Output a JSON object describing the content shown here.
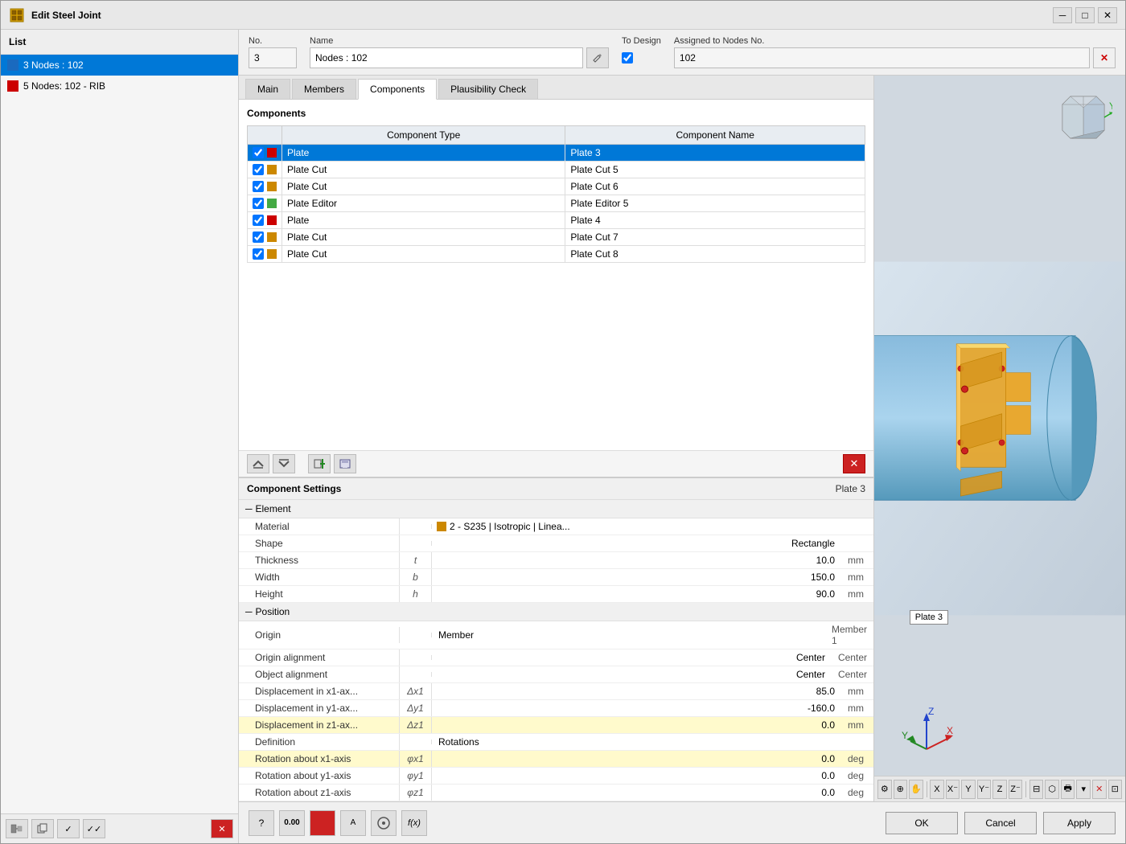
{
  "window": {
    "title": "Edit Steel Joint",
    "icon": "steel-joint-icon"
  },
  "list": {
    "header": "List",
    "items": [
      {
        "id": 1,
        "color": "blue",
        "text": "3 Nodes : 102",
        "selected": true
      },
      {
        "id": 2,
        "color": "red",
        "text": "5 Nodes: 102 - RIB",
        "selected": false
      }
    ]
  },
  "form": {
    "no_label": "No.",
    "no_value": "3",
    "name_label": "Name",
    "name_value": "Nodes : 102",
    "to_design_label": "To Design",
    "assigned_label": "Assigned to Nodes No.",
    "assigned_value": "102"
  },
  "tabs": [
    {
      "id": "main",
      "label": "Main",
      "active": false
    },
    {
      "id": "members",
      "label": "Members",
      "active": false
    },
    {
      "id": "components",
      "label": "Components",
      "active": true
    },
    {
      "id": "plausibility",
      "label": "Plausibility Check",
      "active": false
    }
  ],
  "components": {
    "title": "Components",
    "col_type": "Component Type",
    "col_name": "Component Name",
    "rows": [
      {
        "checked": true,
        "color": "red",
        "type": "Plate",
        "name": "Plate 3",
        "selected": true
      },
      {
        "checked": true,
        "color": "orange",
        "type": "Plate Cut",
        "name": "Plate Cut 5",
        "selected": false
      },
      {
        "checked": true,
        "color": "orange",
        "type": "Plate Cut",
        "name": "Plate Cut 6",
        "selected": false
      },
      {
        "checked": true,
        "color": "green",
        "type": "Plate Editor",
        "name": "Plate Editor 5",
        "selected": false
      },
      {
        "checked": true,
        "color": "red",
        "type": "Plate",
        "name": "Plate 4",
        "selected": false
      },
      {
        "checked": true,
        "color": "orange",
        "type": "Plate Cut",
        "name": "Plate Cut 7",
        "selected": false
      },
      {
        "checked": true,
        "color": "orange",
        "type": "Plate Cut",
        "name": "Plate Cut 8",
        "selected": false
      }
    ]
  },
  "settings": {
    "title": "Component Settings",
    "component_name": "Plate 3",
    "element_group": "Element",
    "properties": [
      {
        "name": "Material",
        "symbol": "",
        "value": "2 - S235 | Isotropic | Linea...",
        "unit": "",
        "type": "material",
        "highlighted": false
      },
      {
        "name": "Shape",
        "symbol": "",
        "value": "Rectangle",
        "unit": "",
        "type": "text",
        "highlighted": false
      },
      {
        "name": "Thickness",
        "symbol": "t",
        "value": "10.0",
        "unit": "mm",
        "type": "number",
        "highlighted": false
      },
      {
        "name": "Width",
        "symbol": "b",
        "value": "150.0",
        "unit": "mm",
        "type": "number",
        "highlighted": false
      },
      {
        "name": "Height",
        "symbol": "h",
        "value": "90.0",
        "unit": "mm",
        "type": "number",
        "highlighted": false
      }
    ],
    "position_group": "Position",
    "position_properties": [
      {
        "name": "Origin",
        "symbol": "",
        "value1": "Member",
        "value2": "Member 1",
        "type": "multi",
        "highlighted": false
      },
      {
        "name": "Origin alignment",
        "symbol": "",
        "value1": "Center",
        "value2": "Center",
        "type": "multi",
        "highlighted": false
      },
      {
        "name": "Object alignment",
        "symbol": "",
        "value1": "Center",
        "value2": "Center",
        "type": "multi",
        "highlighted": false
      },
      {
        "name": "Displacement in x1-ax...",
        "symbol": "Δx1",
        "value": "85.0",
        "unit": "mm",
        "type": "number",
        "highlighted": false
      },
      {
        "name": "Displacement in y1-ax...",
        "symbol": "Δy1",
        "value": "-160.0",
        "unit": "mm",
        "type": "number",
        "highlighted": false
      },
      {
        "name": "Displacement in z1-ax...",
        "symbol": "Δz1",
        "value": "0.0",
        "unit": "mm",
        "type": "number",
        "highlighted": true
      },
      {
        "name": "Definition",
        "symbol": "",
        "value": "Rotations",
        "unit": "",
        "type": "text",
        "highlighted": false
      },
      {
        "name": "Rotation about x1-axis",
        "symbol": "φx1",
        "value": "0.0",
        "unit": "deg",
        "type": "number",
        "highlighted": true
      },
      {
        "name": "Rotation about y1-axis",
        "symbol": "φy1",
        "value": "0.0",
        "unit": "deg",
        "type": "number",
        "highlighted": false
      },
      {
        "name": "Rotation about z1-axis",
        "symbol": "φz1",
        "value": "0.0",
        "unit": "deg",
        "type": "number",
        "highlighted": false
      }
    ]
  },
  "plate_label": "Plate 3",
  "bottom_toolbar": {
    "tools": [
      "help",
      "value",
      "color",
      "text",
      "formula"
    ]
  },
  "buttons": {
    "ok": "OK",
    "cancel": "Cancel",
    "apply": "Apply"
  }
}
